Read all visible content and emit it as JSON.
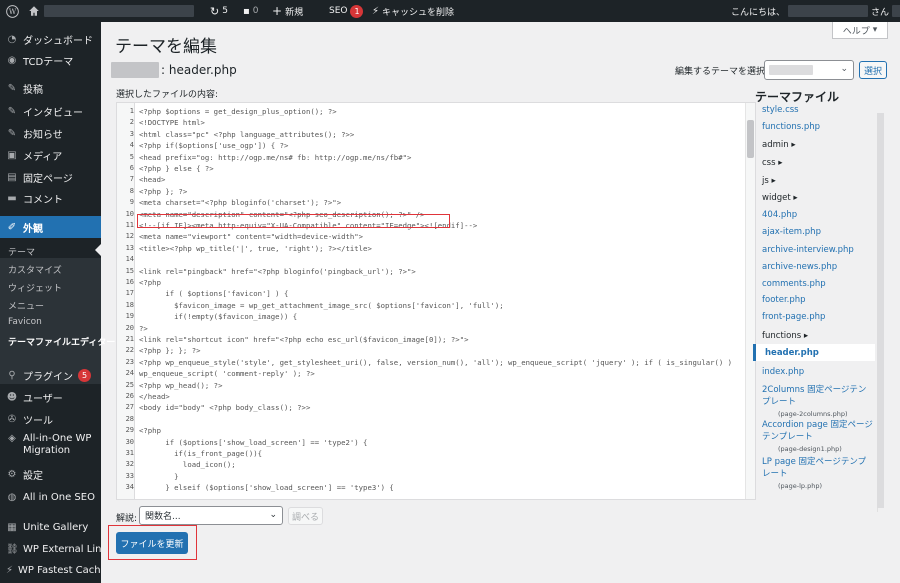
{
  "admin_bar": {
    "icons": {
      "wp": "wordpress-icon",
      "home": "home-icon",
      "updates": "updates-icon",
      "comments": "comment-icon",
      "new": "plus-icon",
      "cache": "cache-icon"
    },
    "updates_count": "5",
    "comments_count": "0",
    "new_label": "新規",
    "seo_label": "SEO",
    "seo_badge": "1",
    "cache_label": "キャッシュを削除",
    "greeting": "こんにちは、",
    "greeting_suffix": "さん"
  },
  "menu": {
    "items": [
      {
        "label": "ダッシュボード",
        "icon": "dashboard-icon"
      },
      {
        "label": "TCDテーマ",
        "icon": "tcd-icon"
      },
      {
        "label": "投稿",
        "icon": "pin-icon"
      },
      {
        "label": "インタビュー",
        "icon": "pin-icon"
      },
      {
        "label": "お知らせ",
        "icon": "pin-icon"
      },
      {
        "label": "メディア",
        "icon": "media-icon"
      },
      {
        "label": "固定ページ",
        "icon": "page-icon"
      },
      {
        "label": "コメント",
        "icon": "comment-icon"
      },
      {
        "label": "外観",
        "icon": "brush-icon"
      },
      {
        "label": "プラグイン",
        "icon": "plugin-icon",
        "badge": "5"
      },
      {
        "label": "ユーザー",
        "icon": "user-icon"
      },
      {
        "label": "ツール",
        "icon": "tools-icon"
      },
      {
        "label": "All-in-One WP Migration",
        "icon": "migration-icon"
      },
      {
        "label": "設定",
        "icon": "settings-icon"
      },
      {
        "label": "All in One SEO",
        "icon": "seo-icon"
      },
      {
        "label": "Unite Gallery",
        "icon": "gallery-icon"
      },
      {
        "label": "WP External Links",
        "icon": "link-icon"
      },
      {
        "label": "WP Fastest Cache",
        "icon": "cache-icon"
      }
    ],
    "submenu": [
      "テーマ",
      "カスタマイズ",
      "ウィジェット",
      "メニュー",
      "Favicon",
      "テーマファイルエディター"
    ]
  },
  "page": {
    "title": "テーマを編集",
    "help": "ヘルプ",
    "file_heading": ": header.php",
    "select_theme_label": "編集するテーマを選択:",
    "select_button": "選択",
    "file_content_label": "選択したファイルの内容:",
    "theme_files_title": "テーマファイル",
    "doc_label": "解説:",
    "doc_select": "関数名...",
    "lookup_button": "調べる",
    "update_button": "ファイルを更新"
  },
  "code_lines": [
    "<?php $options = get_design_plus_option(); ?>",
    "<!DOCTYPE html>",
    "<html class=\"pc\" <?php language_attributes(); ?>>",
    "<?php if($options['use_ogp']) { ?>",
    "<head prefix=\"og: http://ogp.me/ns# fb: http://ogp.me/ns/fb#\">",
    "<?php } else { ?>",
    "<head>",
    "<?php }; ?>",
    "<meta charset=\"<?php bloginfo('charset'); ?>\">",
    "<meta name=\"description\" content=\"<?php seo_description(); ?>\" />",
    "<!--[if IE]><meta http-equiv=\"X-UA-Compatible\" content=\"IE=edge\"><![endif]-->",
    "<meta name=\"viewport\" content=\"width=device-width\">",
    "<title><?php wp_title('|', true, 'right'); ?></title>",
    "",
    "<link rel=\"pingback\" href=\"<?php bloginfo('pingback_url'); ?>\">",
    "<?php",
    "      if ( $options['favicon'] ) {",
    "        $favicon_image = wp_get_attachment_image_src( $options['favicon'], 'full');",
    "        if(!empty($favicon_image)) {",
    "?>",
    "<link rel=\"shortcut icon\" href=\"<?php echo esc_url($favicon_image[0]); ?>\">",
    "<?php }; }; ?>",
    "<?php wp_enqueue_style('style', get_stylesheet_uri(), false, version_num(), 'all'); wp_enqueue_script( 'jquery' ); if ( is_singular() )",
    "wp_enqueue_script( 'comment-reply' ); ?>",
    "<?php wp_head(); ?>",
    "</head>",
    "<body id=\"body\" <?php body_class(); ?>>",
    "",
    "<?php",
    "      if ($options['show_load_screen'] == 'type2') {",
    "        if(is_front_page()){",
    "          load_icon();",
    "        }",
    "      } elseif ($options['show_load_screen'] == 'type3') {"
  ],
  "files": [
    {
      "name": "style.css"
    },
    {
      "name": "functions.php"
    },
    {
      "name": "admin",
      "dir": true
    },
    {
      "name": "css",
      "dir": true
    },
    {
      "name": "js",
      "dir": true
    },
    {
      "name": "widget",
      "dir": true
    },
    {
      "name": "404.php"
    },
    {
      "name": "ajax-item.php"
    },
    {
      "name": "archive-interview.php"
    },
    {
      "name": "archive-news.php"
    },
    {
      "name": "comments.php"
    },
    {
      "name": "footer.php"
    },
    {
      "name": "front-page.php"
    },
    {
      "name": "functions",
      "dir": true
    },
    {
      "name": "header.php",
      "current": true
    },
    {
      "name": "index.php"
    },
    {
      "name": "2Columns 固定ページテンプレート",
      "sub": "(page-2columns.php)"
    },
    {
      "name": "Accordion page 固定ページテンプレート",
      "sub": "(page-design1.php)"
    },
    {
      "name": "LP page 固定ページテンプレート",
      "sub": "(page-lp.php)"
    }
  ],
  "colors": {
    "accent": "#2271b1",
    "admin_bg": "#1d2327",
    "highlight": "#e0343a"
  }
}
